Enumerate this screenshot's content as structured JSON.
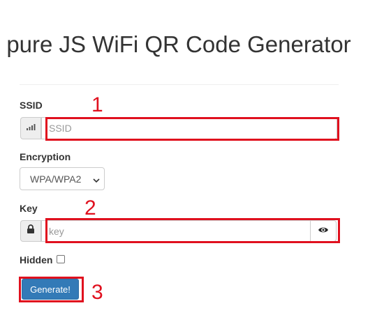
{
  "page": {
    "title": "pure JS WiFi QR Code Generator"
  },
  "form": {
    "ssid_label": "SSID",
    "ssid_placeholder": "SSID",
    "encryption_label": "Encryption",
    "encryption_selected": "WPA/WPA2",
    "key_label": "Key",
    "key_placeholder": "key",
    "hidden_label": "Hidden",
    "hidden_checked": false,
    "generate_label": "Generate!"
  },
  "icons": {
    "ssid_addon": "signal-icon",
    "key_addon": "lock-icon",
    "show_key": "eye-icon",
    "select_arrow": "chevron-down-icon"
  },
  "annotations": {
    "step1": "1",
    "step2": "2",
    "step3": "3",
    "color": "#e0101e"
  },
  "colors": {
    "primary_button": "#337ab7",
    "addon_background": "#eeeeee",
    "border": "#cccccc"
  }
}
